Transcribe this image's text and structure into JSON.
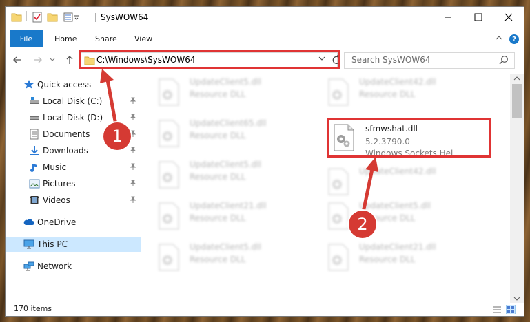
{
  "window": {
    "title": "SysWOW64"
  },
  "ribbon": {
    "tabs": [
      "File",
      "Home",
      "Share",
      "View"
    ],
    "help_label": "?"
  },
  "navbar": {
    "address": "C:\\Windows\\SysWOW64",
    "search_placeholder": "Search SysWOW64"
  },
  "sidebar": {
    "items": [
      {
        "label": "Quick access",
        "icon": "star-icon"
      },
      {
        "label": "Local Disk (C:)",
        "icon": "drive-icon"
      },
      {
        "label": "Local Disk (D:)",
        "icon": "drive-icon"
      },
      {
        "label": "Documents",
        "icon": "documents-icon"
      },
      {
        "label": "Downloads",
        "icon": "downloads-icon"
      },
      {
        "label": "Music",
        "icon": "music-icon"
      },
      {
        "label": "Pictures",
        "icon": "pictures-icon"
      },
      {
        "label": "Videos",
        "icon": "videos-icon"
      },
      {
        "label": "OneDrive",
        "icon": "cloud-icon"
      },
      {
        "label": "This PC",
        "icon": "pc-icon"
      },
      {
        "label": "Network",
        "icon": "network-icon"
      }
    ]
  },
  "files": [
    {
      "name": "UpdateClient5.dll",
      "type": "Resource DLL"
    },
    {
      "name": "UpdateClient42.dll",
      "type": "Resource DLL"
    },
    {
      "name": "UpdateClient65.dll",
      "type": "Resource DLL"
    },
    {
      "name": "sfmwshat.dll",
      "version": "5.2.3790.0",
      "description": "Windows Sockets Hel..."
    },
    {
      "name": "UpdateClient5.dll",
      "type": "Resource DLL"
    },
    {
      "name": "UpdateClient42.dll",
      "type": "Resource DLL"
    },
    {
      "name": "UpdateClient21.dll",
      "type": "Resource DLL"
    },
    {
      "name": "UpdateClient5.dll",
      "type": "Resource DLL"
    },
    {
      "name": "UpdateClient5.dll",
      "type": "Resource DLL"
    },
    {
      "name": "UpdateClient21.dll",
      "type": "Resource DLL"
    }
  ],
  "status": {
    "item_count": "170 items"
  },
  "callouts": [
    "1",
    "2"
  ],
  "colors": {
    "highlight": "#e03434",
    "callout": "#d53a33",
    "accent": "#1979ca",
    "selected": "#cce8ff"
  }
}
